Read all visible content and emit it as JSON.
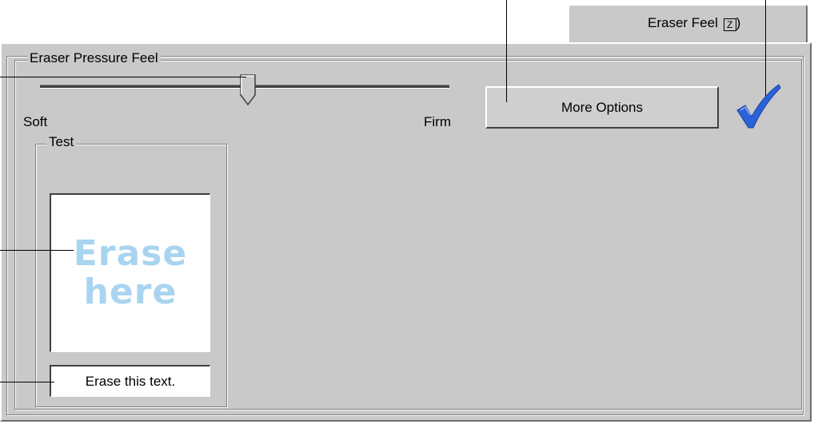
{
  "tab": {
    "label": "Eraser Feel",
    "shortcut_key": "Z",
    "close_paren": ")"
  },
  "group": {
    "title": "Eraser Pressure Feel"
  },
  "slider": {
    "min_label": "Soft",
    "max_label": "Firm",
    "value_fraction": 0.52
  },
  "more_options_button": {
    "label": "More Options"
  },
  "test_group": {
    "title": "Test",
    "erase_area_lines": [
      "Erase",
      "here"
    ],
    "erase_field_text": "Erase this text."
  },
  "colors": {
    "panel": "#c9c9c9",
    "erase_text": "#a9d4f0",
    "checkmark": "#2a62d9"
  },
  "icons": {
    "apply": "checkmark-icon"
  }
}
